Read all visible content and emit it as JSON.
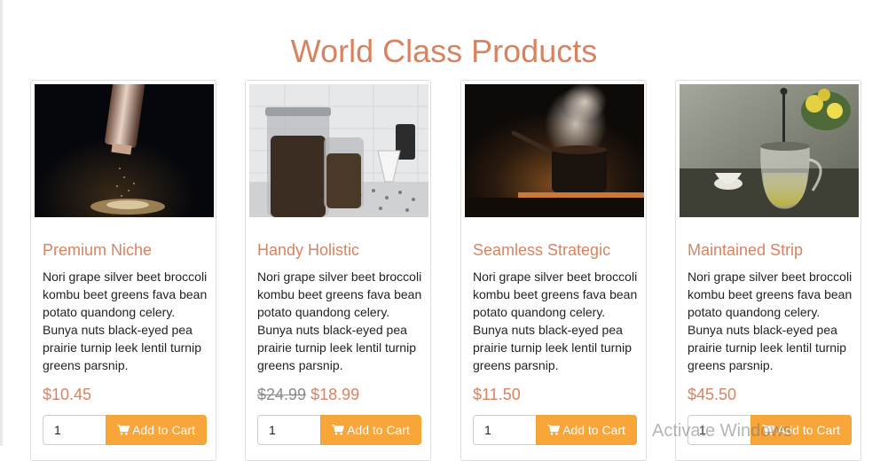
{
  "page": {
    "title": "World Class Products"
  },
  "colors": {
    "accent": "#d9825f",
    "button": "#f8a53a",
    "text": "#222222",
    "old_price": "#8a8a8a"
  },
  "products": [
    {
      "name": "Premium Niche",
      "description": "Nori grape silver beet broccoli kombu beet greens fava bean potato quandong celery. Bunya nuts black-eyed pea prairie turnip leek lentil turnip greens parsnip.",
      "old_price": "",
      "price": "$10.45",
      "quantity": "1",
      "button_label": "Add to Cart",
      "button_icon": "shopping-cart-icon",
      "image": "pepper-grinder-photo"
    },
    {
      "name": "Handy Holistic",
      "description": "Nori grape silver beet broccoli kombu beet greens fava bean potato quandong celery. Bunya nuts black-eyed pea prairie turnip leek lentil turnip greens parsnip.",
      "old_price": "$24.99",
      "price": "$18.99",
      "quantity": "1",
      "button_label": "Add to Cart",
      "button_icon": "shopping-cart-icon",
      "image": "coffee-jars-photo"
    },
    {
      "name": "Seamless Strategic",
      "description": "Nori grape silver beet broccoli kombu beet greens fava bean potato quandong celery. Bunya nuts black-eyed pea prairie turnip leek lentil turnip greens parsnip.",
      "old_price": "",
      "price": "$11.50",
      "quantity": "1",
      "button_label": "Add to Cart",
      "button_icon": "shopping-cart-icon",
      "image": "steaming-pot-photo"
    },
    {
      "name": "Maintained Strip",
      "description": "Nori grape silver beet broccoli kombu beet greens fava bean potato quandong celery. Bunya nuts black-eyed pea prairie turnip leek lentil turnip greens parsnip.",
      "old_price": "",
      "price": "$45.50",
      "quantity": "1",
      "button_label": "Add to Cart",
      "button_icon": "shopping-cart-icon",
      "image": "tea-press-photo"
    }
  ],
  "overlay": {
    "watermark": "Activate Windows"
  }
}
